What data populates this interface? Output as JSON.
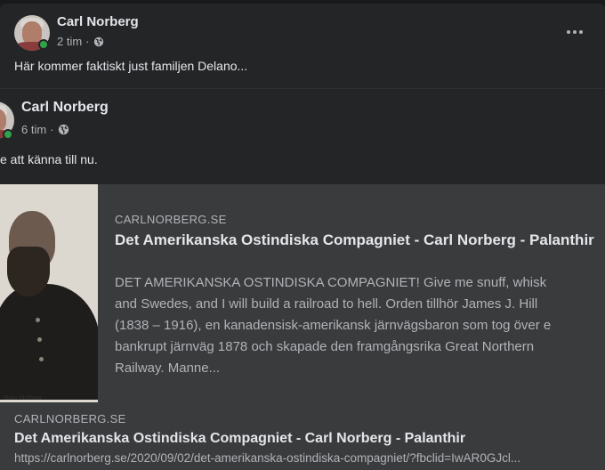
{
  "post": {
    "author": "Carl Norberg",
    "time": "2 tim",
    "privacy_icon": "globe-icon",
    "text": "Här kommer faktiskt just familjen Delano...",
    "more_icon": "more-options-icon"
  },
  "shared_post": {
    "author": "Carl Norberg",
    "time": "6 tim",
    "privacy_icon": "globe-icon",
    "text": "e att känna till nu.",
    "card": {
      "domain": "CARLNORBERG.SE",
      "title": "Det Amerikanska Ostindiska Compagniet - Carl Norberg - Palanthir",
      "description": "DET AMERIKANSKA OSTINDISKA COMPAGNIET! Give me snuff, whisk\nand Swedes, and I will build a railroad to hell. Orden tillhör James J. Hill\n(1838 – 1916), en kanadensisk-amerikansk järnvägsbaron som tog över e\nbankrupt järnväg 1878 och skapade den framgångsrika Great Northern\nRailway. Manne...",
      "image_caption": "Hans Mattson"
    }
  },
  "link_preview": {
    "domain": "CARLNORBERG.SE",
    "title": "Det Amerikanska Ostindiska Compagniet - Carl Norberg - Palanthir",
    "url": "https://carlnorberg.se/2020/09/02/det-amerikanska-ostindiska-compagniet/?fbclid=IwAR0GJcl..."
  },
  "colors": {
    "background": "#18191a",
    "card": "#242526",
    "link_area": "#3a3b3c",
    "primary_text": "#e4e6eb",
    "secondary_text": "#b0b3b8",
    "online": "#31a24c"
  }
}
